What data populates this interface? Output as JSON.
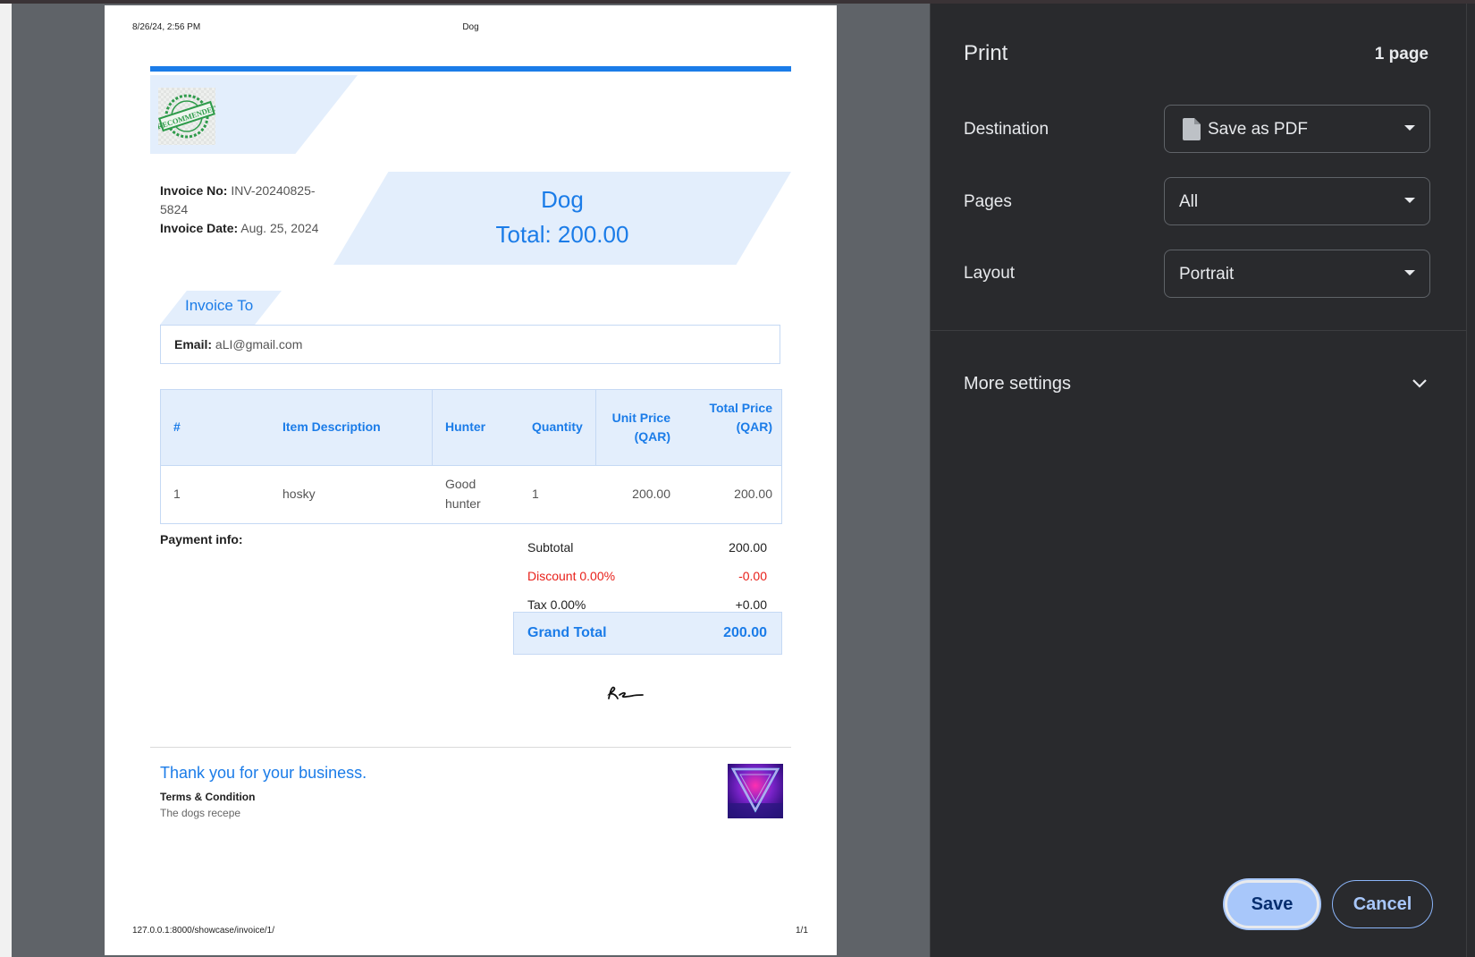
{
  "preview": {
    "header_datetime": "8/26/24, 2:56 PM",
    "header_title": "Dog",
    "footer_url": "127.0.0.1:8000/showcase/invoice/1/",
    "footer_page": "1/1"
  },
  "invoice": {
    "stamp_text": "RECOMMENDED",
    "number_label": "Invoice No:",
    "number_value": "INV-20240825-5824",
    "date_label": "Invoice Date:",
    "date_value": "Aug. 25, 2024",
    "name": "Dog",
    "total_label": "Total: 200.00",
    "invoice_to_label": "Invoice To",
    "email_label": "Email:",
    "email_value": "aLI@gmail.com",
    "table": {
      "headers": [
        "#",
        "Item Description",
        "Hunter",
        "Quantity",
        "Unit Price (QAR)",
        "Total Price (QAR)"
      ],
      "rows": [
        [
          "1",
          "hosky",
          "Good hunter",
          "1",
          "200.00",
          "200.00"
        ]
      ]
    },
    "payment_info_label": "Payment info:",
    "subtotal_label": "Subtotal",
    "subtotal_value": "200.00",
    "discount_label": "Discount 0.00%",
    "discount_value": "-0.00",
    "tax_label": "Tax 0.00%",
    "tax_value": "+0.00",
    "grand_total_label": "Grand Total",
    "grand_total_value": "200.00",
    "thanks": "Thank you for your business.",
    "terms_heading": "Terms & Condition",
    "terms_body": "The dogs recepe"
  },
  "print_panel": {
    "title": "Print",
    "page_count": "1 page",
    "destination_label": "Destination",
    "destination_value": "Save as PDF",
    "destination_icon": "document-icon",
    "pages_label": "Pages",
    "pages_value": "All",
    "layout_label": "Layout",
    "layout_value": "Portrait",
    "more_settings_label": "More settings",
    "save_label": "Save",
    "cancel_label": "Cancel"
  },
  "colors": {
    "accent": "#1b7ce8",
    "accent_light": "#e3eefc",
    "discount_red": "#e8201a",
    "panel_bg": "#292a2d",
    "save_button": "#a8c7fa"
  }
}
